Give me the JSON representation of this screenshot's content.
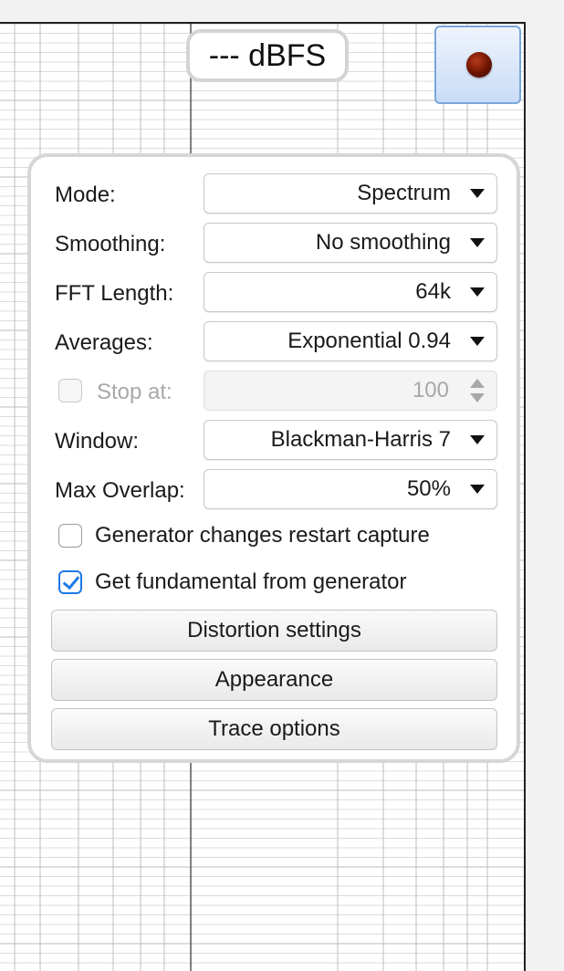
{
  "readout": {
    "level_text": "--- dBFS"
  },
  "record": {
    "dot_color": "#6b1300",
    "button_color": "#c9dcf6"
  },
  "settings": {
    "mode": {
      "label": "Mode:",
      "value": "Spectrum"
    },
    "smoothing": {
      "label": "Smoothing:",
      "value": "No smoothing"
    },
    "fft_length": {
      "label": "FFT Length:",
      "value": "64k"
    },
    "averages": {
      "label": "Averages:",
      "value": "Exponential 0.94"
    },
    "stop_at": {
      "label": "Stop at:",
      "value": "100",
      "checked": false,
      "enabled": false
    },
    "window": {
      "label": "Window:",
      "value": "Blackman-Harris 7"
    },
    "max_overlap": {
      "label": "Max Overlap:",
      "value": "50%"
    },
    "generator_restart": {
      "label": "Generator changes restart capture",
      "checked": false
    },
    "fundamental_from_generator": {
      "label": "Get fundamental from generator",
      "checked": true
    },
    "buttons": {
      "distortion": "Distortion settings",
      "appearance": "Appearance",
      "trace_options": "Trace options"
    }
  },
  "colors": {
    "accent": "#1f78e6",
    "panel_border": "#d6d6d6",
    "grid": "#cfcfcf"
  }
}
